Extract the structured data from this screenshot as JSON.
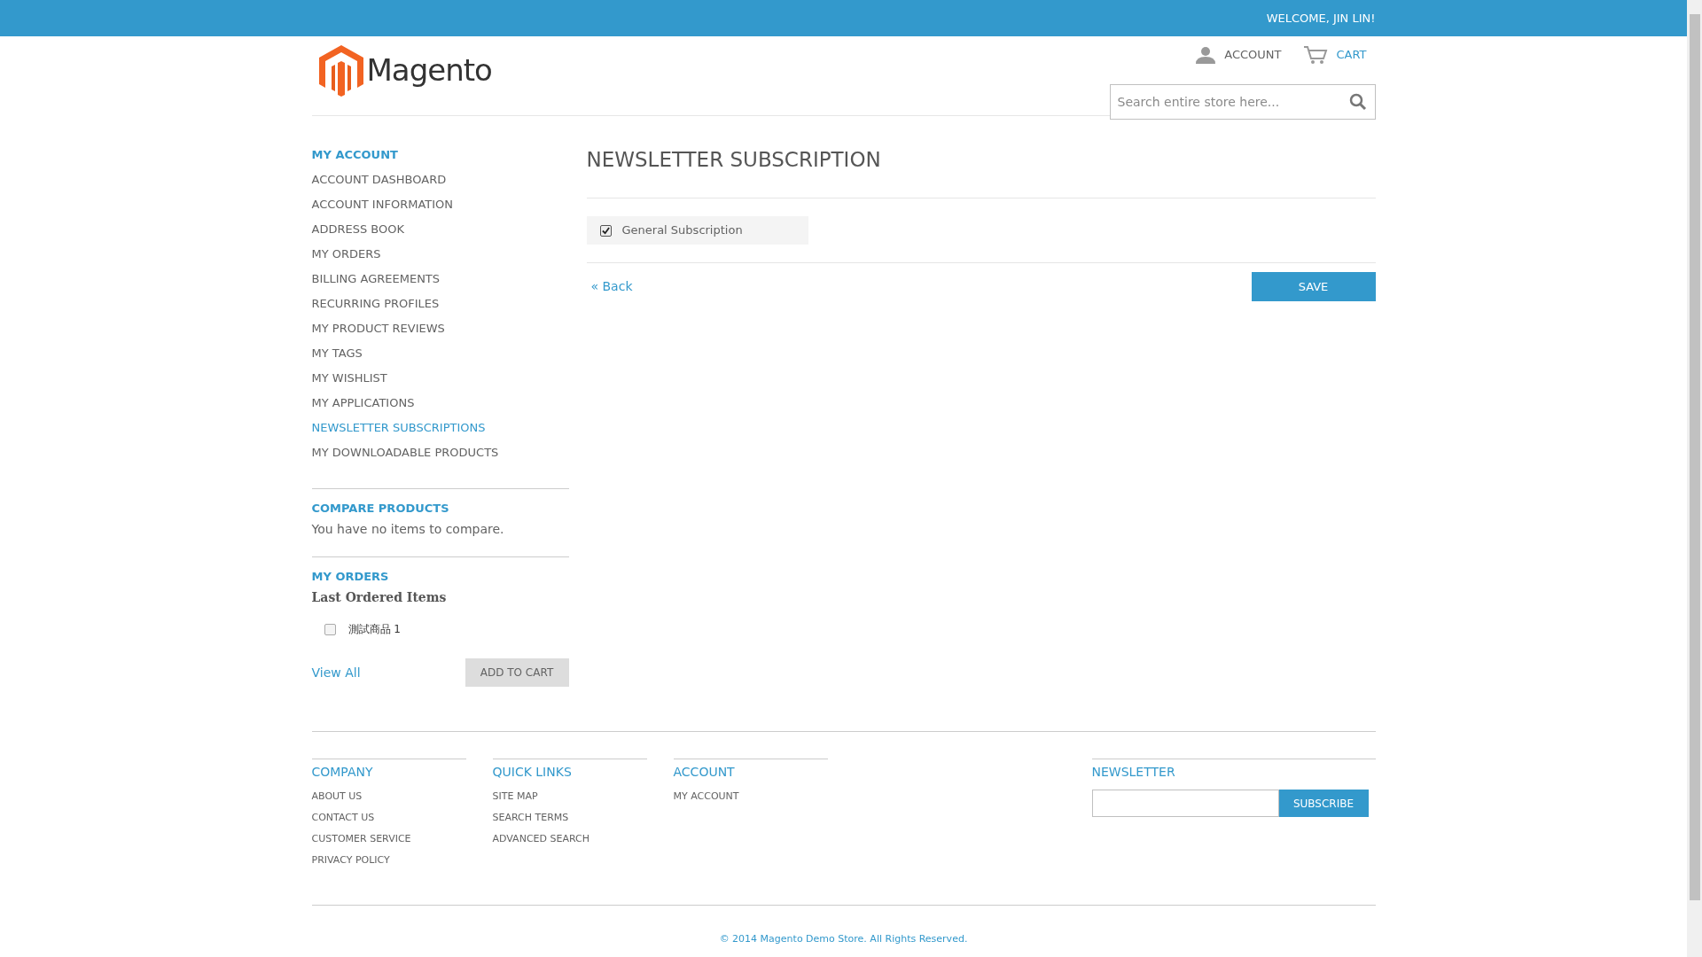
{
  "top_bar": {
    "welcome": "WELCOME, JIN LIN!"
  },
  "header": {
    "logo": "Magento",
    "account_link": "ACCOUNT",
    "cart_link": "CART",
    "search": {
      "placeholder": "Search entire store here..."
    }
  },
  "sidebar": {
    "title": "MY ACCOUNT",
    "items": [
      {
        "label": "ACCOUNT DASHBOARD",
        "selected": false
      },
      {
        "label": "ACCOUNT INFORMATION",
        "selected": false
      },
      {
        "label": "ADDRESS BOOK",
        "selected": false
      },
      {
        "label": "MY ORDERS",
        "selected": false
      },
      {
        "label": "BILLING AGREEMENTS",
        "selected": false
      },
      {
        "label": "RECURRING PROFILES",
        "selected": false
      },
      {
        "label": "MY PRODUCT REVIEWS",
        "selected": false
      },
      {
        "label": "MY TAGS",
        "selected": false
      },
      {
        "label": "MY WISHLIST",
        "selected": false
      },
      {
        "label": "MY APPLICATIONS",
        "selected": false
      },
      {
        "label": "NEWSLETTER SUBSCRIPTIONS",
        "selected": true
      },
      {
        "label": "MY DOWNLOADABLE PRODUCTS",
        "selected": false
      }
    ],
    "compare": {
      "title": "COMPARE PRODUCTS",
      "text": "You have no items to compare."
    },
    "orders": {
      "title": "MY ORDERS",
      "subtitle": "Last Ordered Items",
      "items": [
        {
          "label": "測試商品 1",
          "checked": false
        }
      ],
      "view_all": "View All",
      "add_to_cart": "ADD TO CART"
    }
  },
  "main": {
    "title": "NEWSLETTER SUBSCRIPTION",
    "subscription": {
      "label": "General Subscription",
      "checked": true
    },
    "back": "« Back",
    "save": "SAVE"
  },
  "footer": {
    "columns": [
      {
        "title": "COMPANY",
        "links": [
          "ABOUT US",
          "CONTACT US",
          "CUSTOMER SERVICE",
          "PRIVACY POLICY"
        ]
      },
      {
        "title": "QUICK LINKS",
        "links": [
          "SITE MAP",
          "SEARCH TERMS",
          "ADVANCED SEARCH"
        ]
      },
      {
        "title": "ACCOUNT",
        "links": [
          "MY ACCOUNT"
        ]
      }
    ],
    "newsletter": {
      "title": "NEWSLETTER",
      "button": "SUBSCRIBE"
    },
    "copyright": "© 2014 Magento Demo Store. All Rights Reserved."
  }
}
